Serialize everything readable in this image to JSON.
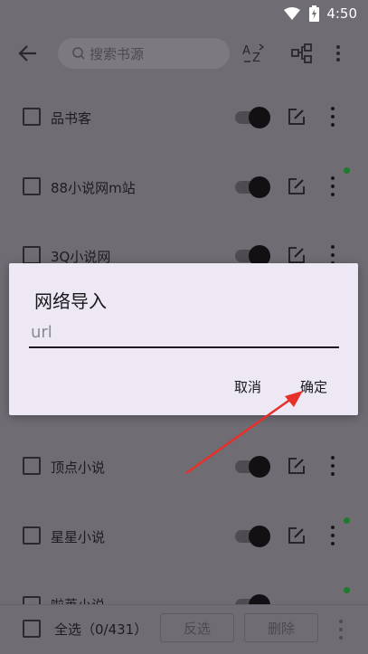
{
  "status_bar": {
    "time": "4:50"
  },
  "toolbar": {
    "search_placeholder": "搜索书源"
  },
  "sources": [
    {
      "name": "品书客",
      "dot": false
    },
    {
      "name": "88小说网m站",
      "dot": true
    },
    {
      "name": "3Q小说网",
      "dot": false
    },
    {
      "name": "顶点小说",
      "dot": false
    },
    {
      "name": "星星小说",
      "dot": true
    },
    {
      "name": "啦莱小说",
      "dot": true
    }
  ],
  "bottom_bar": {
    "select_all": "全选（0/431）",
    "invert": "反选",
    "delete": "删除"
  },
  "dialog": {
    "title": "网络导入",
    "input_placeholder": "url",
    "input_value": "",
    "cancel": "取消",
    "confirm": "确定"
  },
  "colors": {
    "dialog_bg": "#ede8f3",
    "dim_bg": "#6f6c73",
    "arrow": "#e8302a",
    "dot_green": "#1e7a2c"
  }
}
